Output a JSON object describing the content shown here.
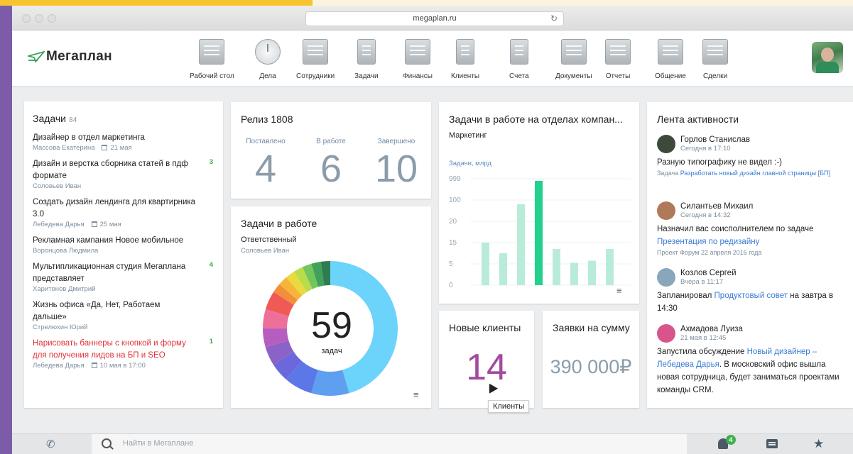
{
  "browser": {
    "url": "megaplan.ru"
  },
  "header": {
    "logo": "Мегаплан",
    "nav": [
      {
        "label": "Рабочий стол",
        "icon": "desktop-icon"
      },
      {
        "label": "Дела",
        "icon": "clock-icon"
      },
      {
        "label": "Сотрудники",
        "icon": "employees-icon"
      },
      {
        "label": "Задачи",
        "icon": "tasks-clipboard-icon"
      },
      {
        "label": "Финансы",
        "icon": "safe-icon"
      },
      {
        "label": "Клиенты",
        "icon": "address-book-icon"
      },
      {
        "label": "Счета",
        "icon": "invoice-icon"
      },
      {
        "label": "Документы",
        "icon": "folder-icon"
      },
      {
        "label": "Отчеты",
        "icon": "report-chart-icon"
      },
      {
        "label": "Общение",
        "icon": "chat-bubbles-icon"
      },
      {
        "label": "Сделки",
        "icon": "briefcase-icon"
      }
    ]
  },
  "tasks": {
    "title": "Задачи",
    "count": "84",
    "items": [
      {
        "title": "Дизайнер в отдел маркетинга",
        "person": "Массова Екатерина",
        "date": "21 мая",
        "badge": "",
        "red": false
      },
      {
        "title": "Дизайн и верстка сборника статей в пдф формате",
        "person": "Соловьев Иван",
        "date": "",
        "badge": "3",
        "red": false
      },
      {
        "title": "Создать дизайн лендинга для квартирника 3.0",
        "person": "Лебедева Дарья",
        "date": "25 мая",
        "badge": "",
        "red": false
      },
      {
        "title": "Рекламная кампания Новое мобильное",
        "person": "Воронцова Людмила",
        "date": "",
        "badge": "",
        "red": false
      },
      {
        "title": "Мультипликационная студия Мегаплана представляет",
        "person": "Харитонов Дмитрий",
        "date": "",
        "badge": "4",
        "red": false
      },
      {
        "title": "Жизнь офиса «Да, Нет, Работаем дальше»",
        "person": "Стрелюхин Юрий",
        "date": "",
        "badge": "",
        "red": false
      },
      {
        "title": "Нарисовать баннеры с кнопкой и форму для получения лидов на БП и SEO",
        "person": "Лебедева Дарья",
        "date": "10 мая в 17:00",
        "badge": "1",
        "red": true
      }
    ]
  },
  "release": {
    "title": "Релиз 1808",
    "stats": [
      {
        "label": "Поставлено",
        "value": "4"
      },
      {
        "label": "В работе",
        "value": "6"
      },
      {
        "label": "Завершено",
        "value": "10"
      }
    ]
  },
  "inwork": {
    "title": "Задачи в работе",
    "subtitle": "Ответственный",
    "person": "Соловьев Иван",
    "total": "59",
    "unit": "задач",
    "segments": [
      {
        "value": 20,
        "color": "#6cd3fa"
      },
      {
        "value": 4,
        "color": "#5f9ff0"
      },
      {
        "value": 3,
        "color": "#5c78e8"
      },
      {
        "value": 2,
        "color": "#6b68dc"
      },
      {
        "value": 2,
        "color": "#8a62c8"
      },
      {
        "value": 2,
        "color": "#b65ec0"
      },
      {
        "value": 2,
        "color": "#ef6f9b"
      },
      {
        "value": 2,
        "color": "#f05a55"
      },
      {
        "value": 1,
        "color": "#f28f3b"
      },
      {
        "value": 1,
        "color": "#f6b53a"
      },
      {
        "value": 1,
        "color": "#e9da3f"
      },
      {
        "value": 1,
        "color": "#b8dc4a"
      },
      {
        "value": 1,
        "color": "#74c55d"
      },
      {
        "value": 1,
        "color": "#3fa15a"
      },
      {
        "value": 1,
        "color": "#2f7d4e"
      }
    ]
  },
  "chart_data": {
    "type": "bar",
    "title": "Задачи в работе на отделах компан...",
    "subtitle": "Маркетинг",
    "ylabel": "Задачи, млрд",
    "yticks": [
      "999",
      "100",
      "20",
      "15",
      "5",
      "0"
    ],
    "ylim": [
      0,
      5
    ],
    "values": [
      2,
      1.5,
      3.8,
      4.9,
      1.7,
      1.05,
      1.15,
      1.7
    ],
    "highlight_index": 3,
    "colors": {
      "normal": "#b8ecd8",
      "highlight": "#22d18c"
    }
  },
  "newclients": {
    "title": "Новые клиенты",
    "value": "14",
    "tooltip": "Клиенты"
  },
  "amount": {
    "title": "Заявки на сумму",
    "value": "390 000₽"
  },
  "activity": {
    "title": "Лента активности",
    "items": [
      {
        "name": "Горлов Станислав",
        "time": "Сегодня в 17:10",
        "text": "Разную типографику не видел :-)",
        "note_prefix": "Задача",
        "note_link": "Разработать новый дизайн главной страницы [БП]",
        "avatar_color": "#3d4a3a"
      },
      {
        "name": "Силантьев Михаил",
        "time": "Сегодня в 14:32",
        "text": "Назначил вас соисполнителем по задаче",
        "text_link": "Презентация по редизайну",
        "note_prefix": "Проект Форум 22 апреля 2016 года",
        "avatar_color": "#b07a5a"
      },
      {
        "name": "Козлов Сергей",
        "time": "Вчера в 11:17",
        "text_pre": "Запланировал",
        "text_link": "Продуктовый совет",
        "text_post": "на завтра в 14:30",
        "avatar_color": "#8aa6bb"
      },
      {
        "name": "Ахмадова Луиза",
        "time": "21 мая в 12:45",
        "text_pre": "Запустила обсуждение",
        "text_link": "Новый дизайнер – Лебедева Дарья",
        "text_post": ". В московский офис вышла новая сотрудница, будет заниматься проектами команды CRM.",
        "avatar_color": "#d9548a"
      }
    ]
  },
  "bottom": {
    "search_placeholder": "Найти в Мегаплане",
    "notif_count": "4"
  }
}
